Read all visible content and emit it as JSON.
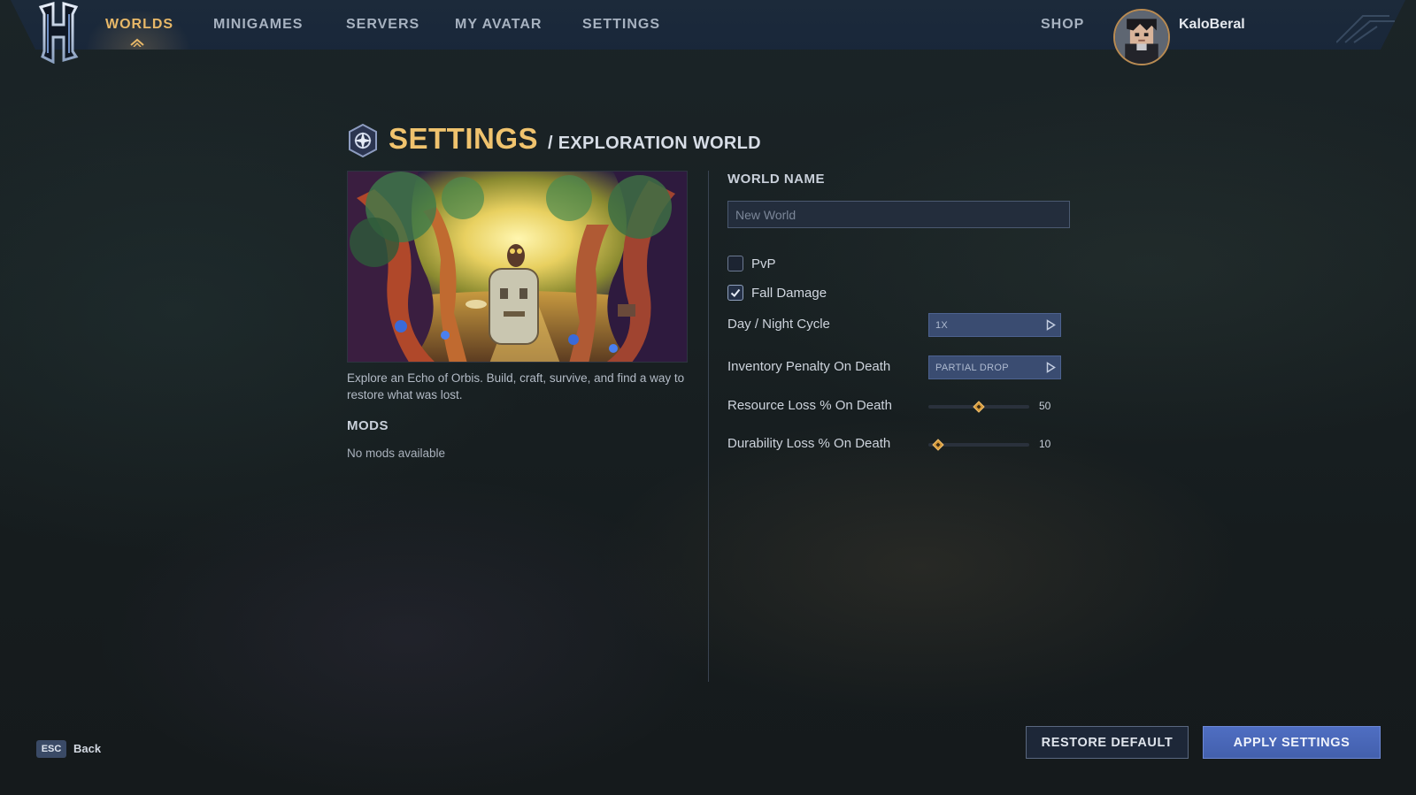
{
  "nav": {
    "items": [
      {
        "label": "WORLDS",
        "active": true
      },
      {
        "label": "MINIGAMES",
        "active": false
      },
      {
        "label": "SERVERS",
        "active": false
      },
      {
        "label": "MY AVATAR",
        "active": false
      },
      {
        "label": "SETTINGS",
        "active": false
      }
    ],
    "shop_label": "SHOP",
    "username": "KaloBeral",
    "logo_icon": "hytale-logo-icon",
    "accent_color": "#e8b868"
  },
  "header": {
    "title": "SETTINGS",
    "subtitle": "/ EXPLORATION WORLD",
    "icon": "world-emblem-icon"
  },
  "world": {
    "description": "Explore an Echo of Orbis. Build, craft, survive, and find a way to restore what was lost.",
    "mods_heading": "MODS",
    "mods_empty": "No mods available"
  },
  "form": {
    "world_name_label": "WORLD NAME",
    "world_name_value": "",
    "world_name_placeholder": "New World",
    "pvp": {
      "label": "PvP",
      "checked": false
    },
    "fall_damage": {
      "label": "Fall Damage",
      "checked": true
    },
    "day_night": {
      "label": "Day / Night Cycle",
      "value": "1X"
    },
    "inventory_penalty": {
      "label": "Inventory Penalty On Death",
      "value": "PARTIAL DROP"
    },
    "resource_loss": {
      "label": "Resource Loss % On Death",
      "value": "50",
      "fraction": 0.5
    },
    "durability_loss": {
      "label": "Durability Loss % On Death",
      "value": "10",
      "fraction": 0.1
    }
  },
  "footer": {
    "esc_key": "ESC",
    "back_label": "Back",
    "restore_label": "RESTORE DEFAULT",
    "apply_label": "APPLY SETTINGS",
    "apply_color": "#4a67b8"
  }
}
